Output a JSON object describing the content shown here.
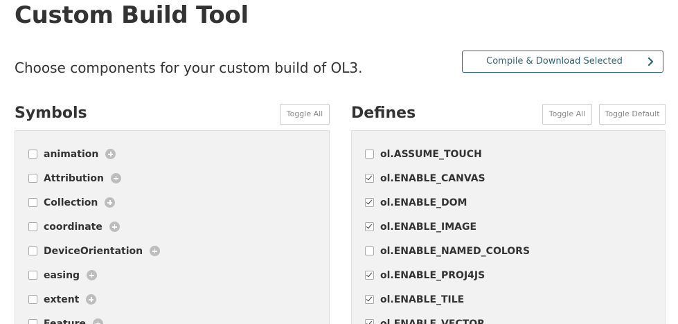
{
  "page": {
    "title": "Custom Build Tool",
    "subtitle": "Choose components for your custom build of OL3."
  },
  "toolbar": {
    "compile_label": "Compile & Download Selected",
    "compile_icon": "chevron-right-icon"
  },
  "symbols": {
    "title": "Symbols",
    "toggle_all_label": "Toggle All",
    "items": [
      {
        "label": "animation",
        "checked": false,
        "icon": "plus-circle-icon"
      },
      {
        "label": "Attribution",
        "checked": false,
        "icon": "plus-circle-icon"
      },
      {
        "label": "Collection",
        "checked": false,
        "icon": "plus-circle-icon"
      },
      {
        "label": "coordinate",
        "checked": false,
        "icon": "plus-circle-icon"
      },
      {
        "label": "DeviceOrientation",
        "checked": false,
        "icon": "plus-circle-icon"
      },
      {
        "label": "easing",
        "checked": false,
        "icon": "plus-circle-icon"
      },
      {
        "label": "extent",
        "checked": false,
        "icon": "plus-circle-icon"
      },
      {
        "label": "Feature",
        "checked": false,
        "icon": "plus-circle-icon"
      }
    ]
  },
  "defines": {
    "title": "Defines",
    "toggle_all_label": "Toggle All",
    "toggle_default_label": "Toggle Default",
    "items": [
      {
        "label": "ol.ASSUME_TOUCH",
        "checked": false
      },
      {
        "label": "ol.ENABLE_CANVAS",
        "checked": true
      },
      {
        "label": "ol.ENABLE_DOM",
        "checked": true
      },
      {
        "label": "ol.ENABLE_IMAGE",
        "checked": true
      },
      {
        "label": "ol.ENABLE_NAMED_COLORS",
        "checked": false
      },
      {
        "label": "ol.ENABLE_PROJ4JS",
        "checked": true
      },
      {
        "label": "ol.ENABLE_TILE",
        "checked": true
      },
      {
        "label": "ol.ENABLE_VECTOR",
        "checked": true
      }
    ]
  },
  "colors": {
    "text": "#333333",
    "accent": "#2c6378",
    "panel_bg": "#f2f2f2",
    "panel_border": "#dddddd",
    "muted": "#888888",
    "plus_icon": "#bdbdbd"
  }
}
